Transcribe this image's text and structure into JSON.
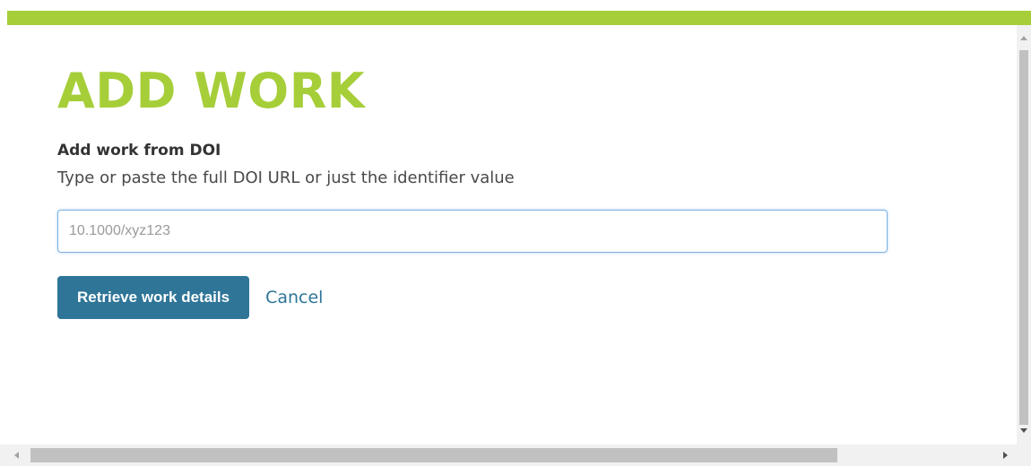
{
  "colors": {
    "accent_green": "#a6ce39",
    "primary_button": "#2e7597",
    "link": "#2e7597"
  },
  "dialog": {
    "title": "ADD WORK",
    "section_heading": "Add work from DOI",
    "section_description": "Type or paste the full DOI URL or just the identifier value",
    "doi_input": {
      "value": "",
      "placeholder": "10.1000/xyz123"
    },
    "retrieve_button_label": "Retrieve work details",
    "cancel_label": "Cancel"
  },
  "scrollbars": {
    "vertical_icons": [
      "scroll-up-arrow-icon",
      "scroll-down-arrow-icon"
    ],
    "horizontal_icons": [
      "scroll-left-arrow-icon",
      "scroll-right-arrow-icon"
    ]
  }
}
